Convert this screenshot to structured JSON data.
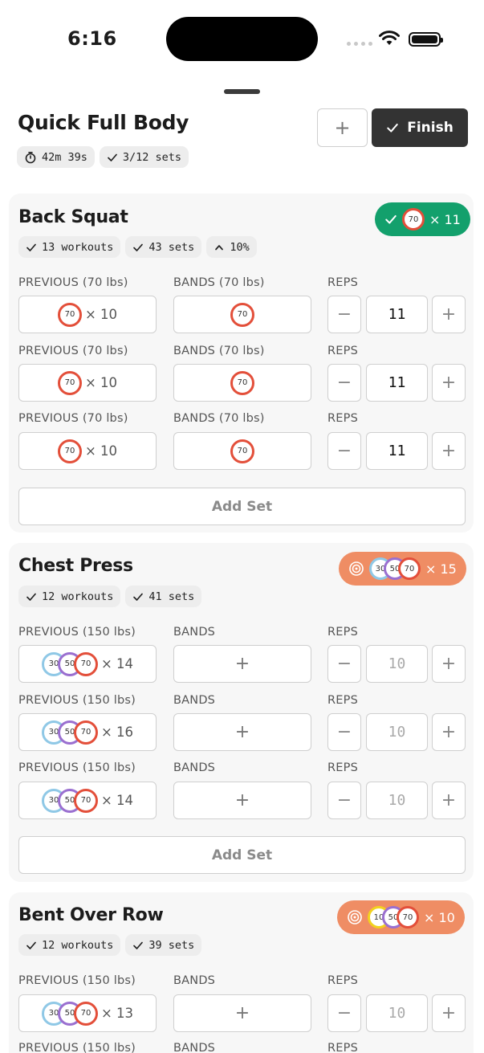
{
  "status_bar": {
    "time": "6:16"
  },
  "workout": {
    "title": "Quick Full Body",
    "elapsed": "42m 39s",
    "sets_progress": "3/12 sets",
    "add_label": "+",
    "finish_label": "Finish"
  },
  "labels": {
    "bands": "BANDS",
    "reps": "REPS",
    "add_set": "Add Set",
    "minus": "−",
    "plus": "+"
  },
  "exercises": [
    {
      "name": "Back Squat",
      "stats": [
        "13 workouts",
        "43 sets",
        "10%"
      ],
      "summary": {
        "status": "completed",
        "bands": [
          "70"
        ],
        "reps": "× 11",
        "color": "#13a06c"
      },
      "sets": [
        {
          "previous_label": "PREVIOUS (70 lbs)",
          "previous_bands": [
            "70"
          ],
          "previous_reps": "× 10",
          "bands_label": "BANDS (70 lbs)",
          "bands": [
            "70"
          ],
          "reps": "11"
        },
        {
          "previous_label": "PREVIOUS (70 lbs)",
          "previous_bands": [
            "70"
          ],
          "previous_reps": "× 10",
          "bands_label": "BANDS (70 lbs)",
          "bands": [
            "70"
          ],
          "reps": "11"
        },
        {
          "previous_label": "PREVIOUS (70 lbs)",
          "previous_bands": [
            "70"
          ],
          "previous_reps": "× 10",
          "bands_label": "BANDS (70 lbs)",
          "bands": [
            "70"
          ],
          "reps": "11"
        }
      ]
    },
    {
      "name": "Chest Press",
      "stats": [
        "12 workouts",
        "41 sets"
      ],
      "summary": {
        "status": "target",
        "bands": [
          "30",
          "50",
          "70"
        ],
        "reps": "× 15",
        "color": "#ef8d64"
      },
      "sets": [
        {
          "previous_label": "PREVIOUS (150 lbs)",
          "previous_bands": [
            "30",
            "50",
            "70"
          ],
          "previous_reps": "× 14",
          "bands_label": "BANDS",
          "reps_placeholder": "10"
        },
        {
          "previous_label": "PREVIOUS (150 lbs)",
          "previous_bands": [
            "30",
            "50",
            "70"
          ],
          "previous_reps": "× 16",
          "bands_label": "BANDS",
          "reps_placeholder": "10"
        },
        {
          "previous_label": "PREVIOUS (150 lbs)",
          "previous_bands": [
            "30",
            "50",
            "70"
          ],
          "previous_reps": "× 14",
          "bands_label": "BANDS",
          "reps_placeholder": "10"
        }
      ]
    },
    {
      "name": "Bent Over Row",
      "stats": [
        "12 workouts",
        "39 sets"
      ],
      "summary": {
        "status": "target",
        "bands": [
          "10",
          "50",
          "70"
        ],
        "reps": "× 10",
        "color": "#ef8d64"
      },
      "sets": [
        {
          "previous_label": "PREVIOUS (150 lbs)",
          "previous_bands": [
            "30",
            "50",
            "70"
          ],
          "previous_reps": "× 13",
          "bands_label": "BANDS",
          "reps_placeholder": "10"
        },
        {
          "previous_label": "PREVIOUS (150 lbs)",
          "bands_label": "BANDS"
        }
      ]
    }
  ]
}
